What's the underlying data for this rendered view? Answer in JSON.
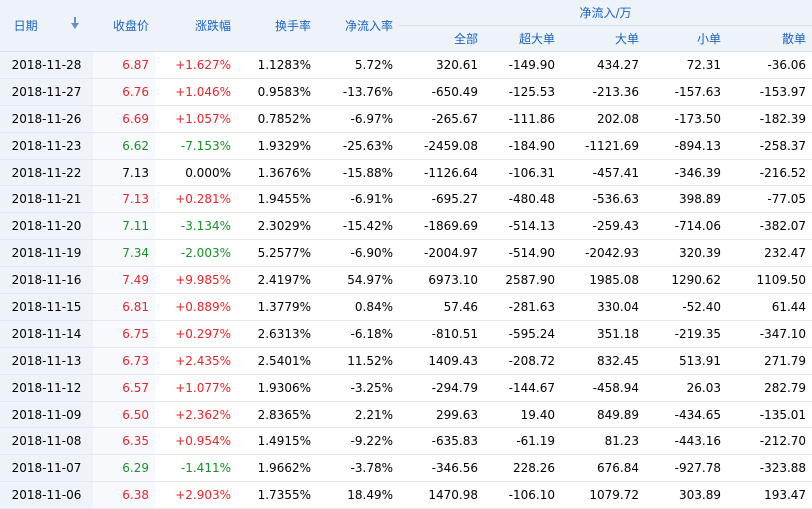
{
  "columns": {
    "date": "日期",
    "close": "收盘价",
    "change": "涨跌幅",
    "turnover": "换手率",
    "net_rate": "净流入率",
    "net_flow": "净流入/万",
    "all": "全部",
    "super": "超大单",
    "large": "大单",
    "small": "小单",
    "retail": "散单"
  },
  "rows": [
    {
      "date": "2018-11-28",
      "close": "6.87",
      "change": "+1.627%",
      "turnover": "1.1283%",
      "net_rate": "5.72%",
      "all": "320.61",
      "super": "-149.90",
      "large": "434.27",
      "small": "72.31",
      "retail": "-36.06",
      "dir": "up"
    },
    {
      "date": "2018-11-27",
      "close": "6.76",
      "change": "+1.046%",
      "turnover": "0.9583%",
      "net_rate": "-13.76%",
      "all": "-650.49",
      "super": "-125.53",
      "large": "-213.36",
      "small": "-157.63",
      "retail": "-153.97",
      "dir": "up"
    },
    {
      "date": "2018-11-26",
      "close": "6.69",
      "change": "+1.057%",
      "turnover": "0.7852%",
      "net_rate": "-6.97%",
      "all": "-265.67",
      "super": "-111.86",
      "large": "202.08",
      "small": "-173.50",
      "retail": "-182.39",
      "dir": "up"
    },
    {
      "date": "2018-11-23",
      "close": "6.62",
      "change": "-7.153%",
      "turnover": "1.9329%",
      "net_rate": "-25.63%",
      "all": "-2459.08",
      "super": "-184.90",
      "large": "-1121.69",
      "small": "-894.13",
      "retail": "-258.37",
      "dir": "down"
    },
    {
      "date": "2018-11-22",
      "close": "7.13",
      "change": "0.000%",
      "turnover": "1.3676%",
      "net_rate": "-15.88%",
      "all": "-1126.64",
      "super": "-106.31",
      "large": "-457.41",
      "small": "-346.39",
      "retail": "-216.52",
      "dir": "flat"
    },
    {
      "date": "2018-11-21",
      "close": "7.13",
      "change": "+0.281%",
      "turnover": "1.9455%",
      "net_rate": "-6.91%",
      "all": "-695.27",
      "super": "-480.48",
      "large": "-536.63",
      "small": "398.89",
      "retail": "-77.05",
      "dir": "up"
    },
    {
      "date": "2018-11-20",
      "close": "7.11",
      "change": "-3.134%",
      "turnover": "2.3029%",
      "net_rate": "-15.42%",
      "all": "-1869.69",
      "super": "-514.13",
      "large": "-259.43",
      "small": "-714.06",
      "retail": "-382.07",
      "dir": "down"
    },
    {
      "date": "2018-11-19",
      "close": "7.34",
      "change": "-2.003%",
      "turnover": "5.2577%",
      "net_rate": "-6.90%",
      "all": "-2004.97",
      "super": "-514.90",
      "large": "-2042.93",
      "small": "320.39",
      "retail": "232.47",
      "dir": "down"
    },
    {
      "date": "2018-11-16",
      "close": "7.49",
      "change": "+9.985%",
      "turnover": "2.4197%",
      "net_rate": "54.97%",
      "all": "6973.10",
      "super": "2587.90",
      "large": "1985.08",
      "small": "1290.62",
      "retail": "1109.50",
      "dir": "up"
    },
    {
      "date": "2018-11-15",
      "close": "6.81",
      "change": "+0.889%",
      "turnover": "1.3779%",
      "net_rate": "0.84%",
      "all": "57.46",
      "super": "-281.63",
      "large": "330.04",
      "small": "-52.40",
      "retail": "61.44",
      "dir": "up"
    },
    {
      "date": "2018-11-14",
      "close": "6.75",
      "change": "+0.297%",
      "turnover": "2.6313%",
      "net_rate": "-6.18%",
      "all": "-810.51",
      "super": "-595.24",
      "large": "351.18",
      "small": "-219.35",
      "retail": "-347.10",
      "dir": "up"
    },
    {
      "date": "2018-11-13",
      "close": "6.73",
      "change": "+2.435%",
      "turnover": "2.5401%",
      "net_rate": "11.52%",
      "all": "1409.43",
      "super": "-208.72",
      "large": "832.45",
      "small": "513.91",
      "retail": "271.79",
      "dir": "up"
    },
    {
      "date": "2018-11-12",
      "close": "6.57",
      "change": "+1.077%",
      "turnover": "1.9306%",
      "net_rate": "-3.25%",
      "all": "-294.79",
      "super": "-144.67",
      "large": "-458.94",
      "small": "26.03",
      "retail": "282.79",
      "dir": "up"
    },
    {
      "date": "2018-11-09",
      "close": "6.50",
      "change": "+2.362%",
      "turnover": "2.8365%",
      "net_rate": "2.21%",
      "all": "299.63",
      "super": "19.40",
      "large": "849.89",
      "small": "-434.65",
      "retail": "-135.01",
      "dir": "up"
    },
    {
      "date": "2018-11-08",
      "close": "6.35",
      "change": "+0.954%",
      "turnover": "1.4915%",
      "net_rate": "-9.22%",
      "all": "-635.83",
      "super": "-61.19",
      "large": "81.23",
      "small": "-443.16",
      "retail": "-212.70",
      "dir": "up"
    },
    {
      "date": "2018-11-07",
      "close": "6.29",
      "change": "-1.411%",
      "turnover": "1.9662%",
      "net_rate": "-3.78%",
      "all": "-346.56",
      "super": "228.26",
      "large": "676.84",
      "small": "-927.78",
      "retail": "-323.88",
      "dir": "down"
    },
    {
      "date": "2018-11-06",
      "close": "6.38",
      "change": "+2.903%",
      "turnover": "1.7355%",
      "net_rate": "18.49%",
      "all": "1470.98",
      "super": "-106.10",
      "large": "1079.72",
      "small": "303.89",
      "retail": "193.47",
      "dir": "up"
    }
  ],
  "colors": {
    "up": "#e0262f",
    "down": "#1b8f2d",
    "header_text": "#1b62c1",
    "header_bg": "#eef3fa"
  },
  "icons": {
    "sort": "sort-down-arrow-icon"
  }
}
